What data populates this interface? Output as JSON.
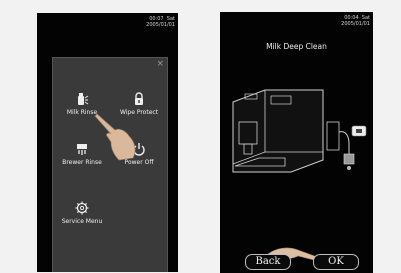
{
  "left_screen": {
    "status_time": "00:07",
    "status_day": "Sat",
    "status_date": "2005/01/01",
    "menu": {
      "close_symbol": "×",
      "items": [
        {
          "label": "Milk Rinse",
          "icon": "milk-rinse-icon"
        },
        {
          "label": "Wipe Protect",
          "icon": "lock-icon"
        },
        {
          "label": "Brewer Rinse",
          "icon": "brewer-rinse-icon"
        },
        {
          "label": "Power Off",
          "icon": "power-icon"
        },
        {
          "label": "Service Menu",
          "icon": "gear-icon"
        }
      ]
    }
  },
  "right_screen": {
    "status_time": "00:04",
    "status_day": "Sat",
    "status_date": "2005/01/01",
    "title": "Milk Deep Clean",
    "back_label": "Back",
    "ok_label": "OK"
  }
}
